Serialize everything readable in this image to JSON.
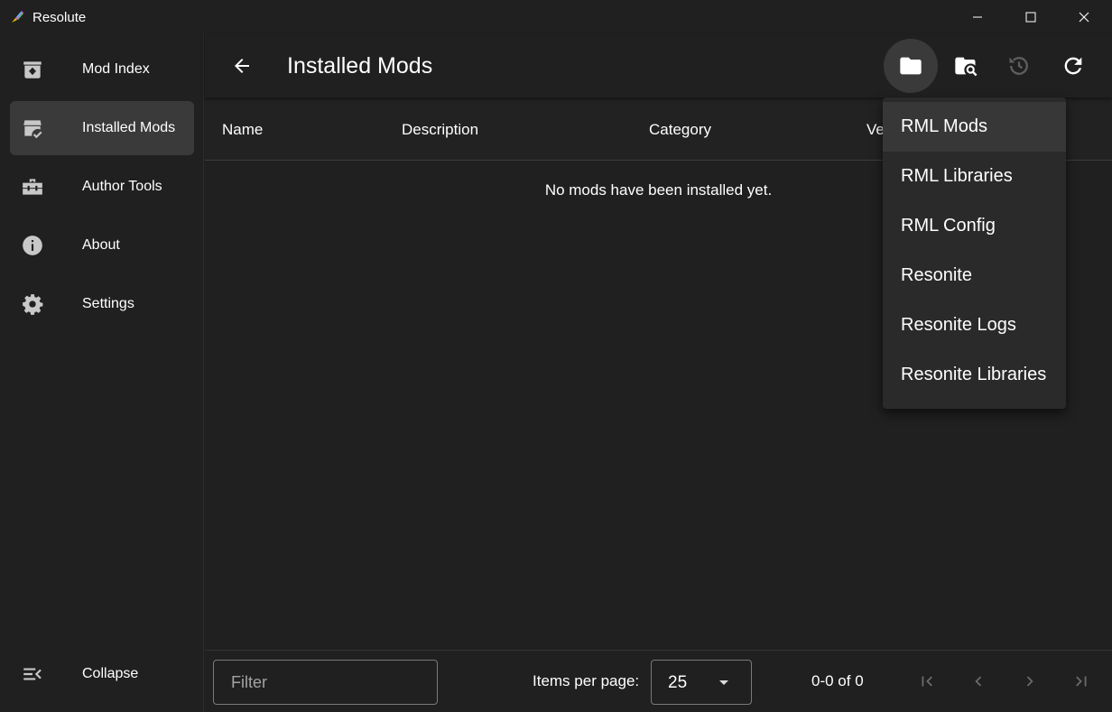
{
  "window": {
    "title": "Resolute",
    "controls": [
      "minimize-icon",
      "maximize-icon",
      "close-icon"
    ]
  },
  "sidebar": {
    "items": [
      {
        "label": "Mod Index",
        "icon": "archive-icon",
        "active": false
      },
      {
        "label": "Installed Mods",
        "icon": "installed-store-icon",
        "active": true
      },
      {
        "label": "Author Tools",
        "icon": "toolbox-icon",
        "active": false
      },
      {
        "label": "About",
        "icon": "info-icon",
        "active": false
      },
      {
        "label": "Settings",
        "icon": "gear-icon",
        "active": false
      }
    ],
    "collapse_label": "Collapse"
  },
  "header": {
    "title": "Installed Mods",
    "actions": [
      "folder-icon",
      "folder-search-icon",
      "history-icon",
      "refresh-icon"
    ]
  },
  "table": {
    "columns": [
      "Name",
      "Description",
      "Category",
      "Ve"
    ],
    "empty_message": "No mods have been installed yet."
  },
  "folder_menu": {
    "items": [
      "RML Mods",
      "RML Libraries",
      "RML Config",
      "Resonite",
      "Resonite Logs",
      "Resonite Libraries"
    ]
  },
  "footer": {
    "filter_placeholder": "Filter",
    "items_per_page_label": "Items per page:",
    "items_per_page_value": "25",
    "range_label": "0-0 of 0"
  },
  "colors": {
    "background": "#202020",
    "active_item": "#3a3a3a",
    "menu_background": "#2a2a2a",
    "text": "#ffffff",
    "disabled_icon": "#5e5e5e"
  }
}
